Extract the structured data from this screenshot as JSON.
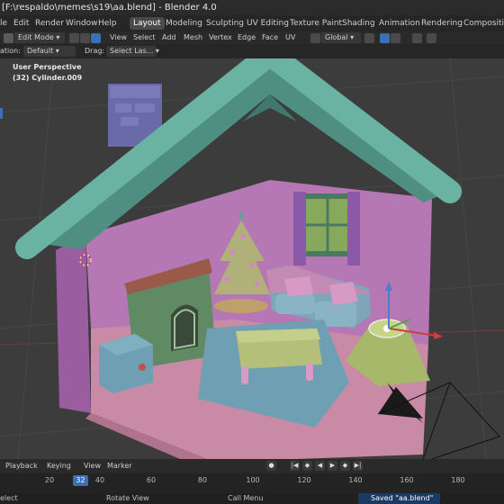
{
  "window": {
    "title": "[F:\\respaldo\\memes\\s19\\aa.blend] - Blender 4.0"
  },
  "menu": {
    "items": [
      "le",
      "Edit",
      "Render",
      "Window",
      "Help"
    ],
    "workspaces": [
      "Layout",
      "Modeling",
      "Sculpting",
      "UV Editing",
      "Texture Paint",
      "Shading",
      "Animation",
      "Rendering",
      "Compositing"
    ],
    "active_workspace": "Layout"
  },
  "header": {
    "mode": "Edit Mode",
    "menus": [
      "View",
      "Select",
      "Add",
      "Mesh",
      "Vertex",
      "Edge",
      "Face",
      "UV"
    ],
    "transform_orientation": "Global"
  },
  "toolsettings": {
    "orientation_label": "ation:",
    "orientation_value": "Default",
    "drag_label": "Drag:",
    "drag_value": "Select Las..."
  },
  "viewport": {
    "view_name": "User Perspective",
    "object_info": "(32) Cylinder.009"
  },
  "timeline": {
    "menus": [
      "Playback",
      "Keying",
      "View",
      "Marker"
    ],
    "current_frame": "32",
    "ticks": [
      "20",
      "40",
      "60",
      "80",
      "100",
      "120",
      "140",
      "160",
      "180"
    ]
  },
  "statusbar": {
    "items": [
      "elect",
      "Rotate View",
      "Call Menu"
    ],
    "message": "Saved \"aa.blend\""
  },
  "colors": {
    "roof": "#5fa394",
    "walls": "#c07fbf",
    "floor": "#c98aa5",
    "rug": "#6f9fb2",
    "sofa": "#7ea6b9",
    "table": "#b4c07a",
    "fireplace": "#5f8a63",
    "lamp": "#a7b86a"
  }
}
